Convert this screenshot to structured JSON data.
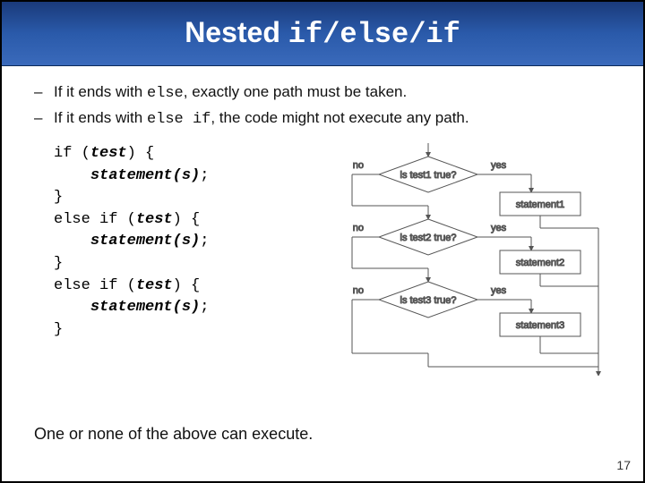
{
  "title": {
    "pre": "Nested ",
    "mono": "if/else/if"
  },
  "bullets": [
    {
      "t1": "If it ends with ",
      "m1": "else",
      "t2": ", exactly one path must be taken."
    },
    {
      "t1": "If it ends with ",
      "m1": "else if",
      "t2": ", the code might not execute any path."
    }
  ],
  "code": {
    "l1a": "if (",
    "l1b": "test",
    "l1c": ") {",
    "l2a": "    ",
    "l2b": "statement(s)",
    "l2c": ";",
    "l3": "}",
    "l4a": "else if (",
    "l4b": "test",
    "l4c": ") {",
    "l5a": "    ",
    "l5b": "statement(s)",
    "l5c": ";",
    "l6": "}",
    "l7a": "else if (",
    "l7b": "test",
    "l7c": ") {",
    "l8a": "    ",
    "l8b": "statement(s)",
    "l8c": ";",
    "l9": "}"
  },
  "diagram": {
    "no": "no",
    "yes": "yes",
    "test1": "is test1 true?",
    "test2": "is test2 true?",
    "test3": "is test3 true?",
    "stmt1": "statement1",
    "stmt2": "statement2",
    "stmt3": "statement3"
  },
  "footer": "One or none of the above can execute.",
  "page": "17"
}
